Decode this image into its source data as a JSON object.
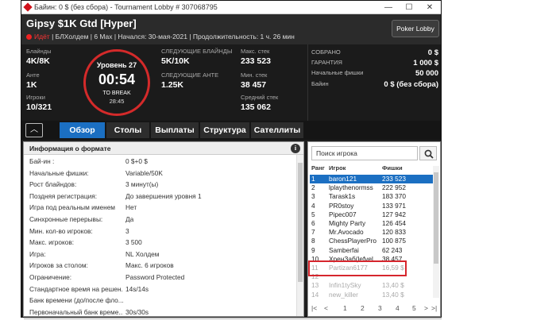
{
  "window": {
    "title": "Байин: 0 $ (без сбора) - Tournament Lobby # 307068795",
    "controls": {
      "minimize": "—",
      "maximize": "☐",
      "close": "✕"
    }
  },
  "header": {
    "tournament_name": "Gipsy $1K Gtd [Hyper]",
    "status": "Идёт",
    "info": "| БЛХолдем | 6 Max | Начался: 30-мая-2021  | Продолжительность: 1 ч. 26 мин",
    "poker_lobby_button": "Poker Lobby"
  },
  "stats": {
    "blinds_label": "Блайнды",
    "blinds_value": "4K/8K",
    "ante_label": "Анте",
    "ante_value": "1K",
    "players_label": "Игроки",
    "players_value": "10/321",
    "level_label": "Уровень 27",
    "time": "00:54",
    "to_break_label": "TO BREAK",
    "to_break_value": "28:45",
    "next_blinds_label": "СЛЕДУЮЩИЕ БЛАЙНДЫ",
    "next_blinds_value": "5K/10K",
    "next_ante_label": "СЛЕДУЮЩИЕ АНТЕ",
    "next_ante_value": "1.25K",
    "max_stack_label": "Макс. стек",
    "max_stack_value": "233 523",
    "min_stack_label": "Мин. стек",
    "min_stack_value": "38 457",
    "avg_stack_label": "Средний стек",
    "avg_stack_value": "135 062"
  },
  "payout": [
    {
      "label": "СОБРАНО",
      "value": "0 $"
    },
    {
      "label": "ГАРАНТИЯ",
      "value": "1 000 $"
    },
    {
      "label": "Начальные фишки",
      "value": "50 000"
    },
    {
      "label": "Байин",
      "value": "0 $ (без сбора)"
    }
  ],
  "tabs": [
    "Обзор",
    "Столы",
    "Выплаты",
    "Структура",
    "Сателлиты"
  ],
  "collapse_icon": "chevron-up-icon",
  "format_info": {
    "title": "Информация о формате",
    "rows": [
      {
        "k": "Бай-ин :",
        "v": "0 $+0 $"
      },
      {
        "k": "Начальные фишки:",
        "v": "Variable/50K"
      },
      {
        "k": "Рост блайндов:",
        "v": "3 минут(ы)"
      },
      {
        "k": "Поздняя регистрация:",
        "v": "До завершения уровня 1"
      },
      {
        "k": "Игра под реальным именем",
        "v": "Нет"
      },
      {
        "k": "Синхронные перерывы:",
        "v": "Да"
      },
      {
        "k": "Мин. кол-во игроков:",
        "v": "3"
      },
      {
        "k": "Макс. игроков:",
        "v": "3 500"
      },
      {
        "k": "Игра:",
        "v": "NL Холдем"
      },
      {
        "k": "Игроков за столом:",
        "v": "Макс. 6 игроков"
      },
      {
        "k": "Ограничение:",
        "v": "Password Protected"
      },
      {
        "k": "Стандартное время на решен...",
        "v": "14s/14s"
      },
      {
        "k": "Банк времени (до/после фло...",
        "v": ""
      },
      {
        "k": "Первоначальный банк време...",
        "v": "30s/30s"
      }
    ]
  },
  "players": {
    "search_placeholder": "Поиск игрока",
    "headers": {
      "rank": "Ранг",
      "name": "Игрок",
      "chips": "Фишки"
    },
    "rows": [
      {
        "rank": "1",
        "name": "baron121",
        "chips": "233 523"
      },
      {
        "rank": "2",
        "name": "lplaythenormss",
        "chips": "222 952"
      },
      {
        "rank": "3",
        "name": "Tarask1s",
        "chips": "183 370"
      },
      {
        "rank": "4",
        "name": "PR0stoy",
        "chips": "133 971"
      },
      {
        "rank": "5",
        "name": "Pipec007",
        "chips": "127 942"
      },
      {
        "rank": "6",
        "name": "Mighty Party",
        "chips": "126 454"
      },
      {
        "rank": "7",
        "name": "Mr.Avocado",
        "chips": "120 833"
      },
      {
        "rank": "8",
        "name": "ChessPlayerPro",
        "chips": "100 875"
      },
      {
        "rank": "9",
        "name": "Samberfai",
        "chips": "62 243"
      },
      {
        "rank": "10",
        "name": "ХренЗаб(lefvel",
        "chips": "38 457"
      },
      {
        "rank": "11",
        "name": "Partizan6177",
        "chips": "16,59 $"
      },
      {
        "rank": "12",
        "name": "",
        "chips": ""
      },
      {
        "rank": "13",
        "name": "Infin1tySky",
        "chips": "13,40 $"
      },
      {
        "rank": "14",
        "name": "new_killer",
        "chips": "13,40 $"
      }
    ],
    "pager": {
      "first": "|<",
      "prev": "<",
      "pages": [
        "1",
        "2",
        "3",
        "4",
        "5"
      ],
      "next": ">",
      "last": ">|"
    }
  }
}
